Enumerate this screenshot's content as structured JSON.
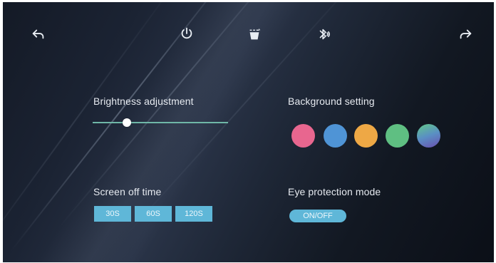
{
  "topbar": {
    "icons": [
      "back-arrow-icon",
      "power-icon",
      "cup-icon",
      "bluetooth-icon",
      "forward-arrow-icon"
    ]
  },
  "brightness": {
    "label": "Brightness adjustment",
    "level_fraction": 0.25,
    "track_color": "#6fb7a7"
  },
  "background": {
    "label": "Background setting",
    "swatches": [
      "#e8668f",
      "#4f94d6",
      "#eea845",
      "#5fbf82",
      "gradient-green-purple"
    ]
  },
  "screen_off": {
    "label": "Screen off time",
    "options": [
      "30S",
      "60S",
      "120S"
    ],
    "button_color": "#5fb7d8"
  },
  "eye_protection": {
    "label": "Eye protection mode",
    "toggle_label": "ON/OFF"
  }
}
